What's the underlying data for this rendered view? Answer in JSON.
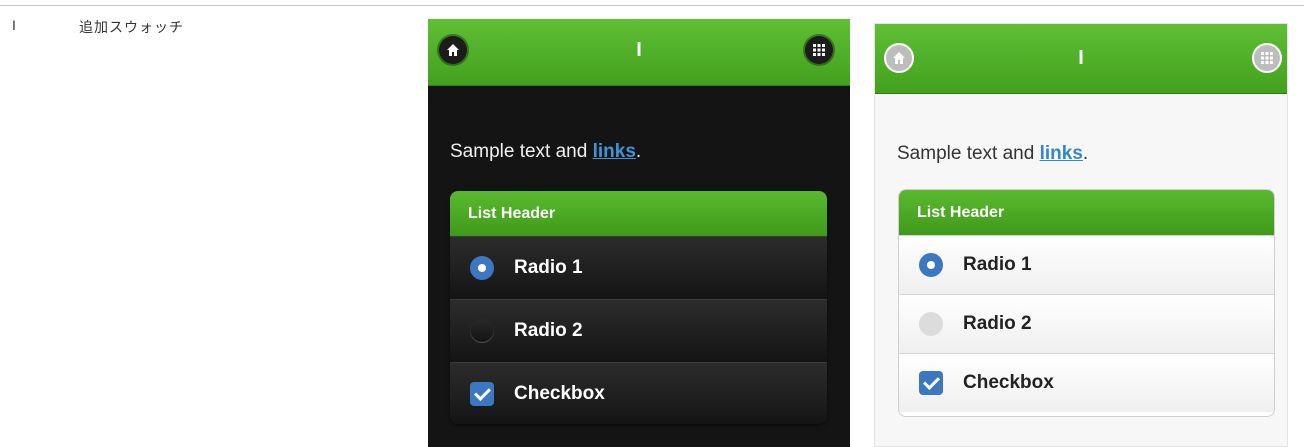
{
  "sidebar": {
    "marker": "I",
    "label": "追加スウォッチ"
  },
  "swatches": {
    "dark": {
      "header_title": "I",
      "sample_prefix": "Sample text and ",
      "link_text": "links",
      "sample_suffix": ".",
      "list_header": "List Header",
      "radio1": "Radio 1",
      "radio2": "Radio 2",
      "checkbox": "Checkbox"
    },
    "light": {
      "header_title": "I",
      "sample_prefix": "Sample text and ",
      "link_text": "links",
      "sample_suffix": ".",
      "list_header": "List Header",
      "radio1": "Radio 1",
      "radio2": "Radio 2",
      "checkbox": "Checkbox"
    }
  },
  "icons": {
    "home": "home-icon",
    "grid": "grid-icon"
  },
  "colors": {
    "accent_green": "#4aa825",
    "link_blue": "#3388cc",
    "radio_blue": "#3c78c2",
    "dark_bg": "#141414",
    "light_bg": "#f7f7f7"
  },
  "state": {
    "radio_selected": 1,
    "checkbox_checked": true
  }
}
